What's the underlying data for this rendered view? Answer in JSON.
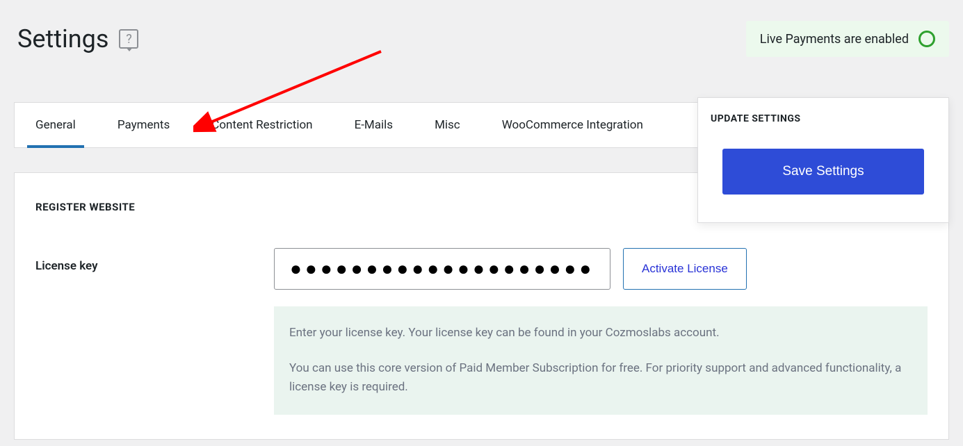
{
  "page": {
    "title": "Settings",
    "status_text": "Live Payments are enabled"
  },
  "tabs": {
    "t0": "General",
    "t1": "Payments",
    "t2": "Content Restriction",
    "t3": "E-Mails",
    "t4": "Misc",
    "t5": "WooCommerce Integration"
  },
  "update_panel": {
    "heading": "UPDATE SETTINGS",
    "save_label": "Save Settings"
  },
  "register_section": {
    "heading": "REGISTER WEBSITE",
    "label": "License key",
    "license_value": "●●●●●●●●●●●●●●●●●●●●●●●●●●●●●●",
    "activate_label": "Activate License",
    "hint_1": "Enter your license key. Your license key can be found in your Cozmoslabs account.",
    "hint_2": "You can use this core version of Paid Member Subscription for free. For priority support and advanced functionality, a license key is required."
  }
}
